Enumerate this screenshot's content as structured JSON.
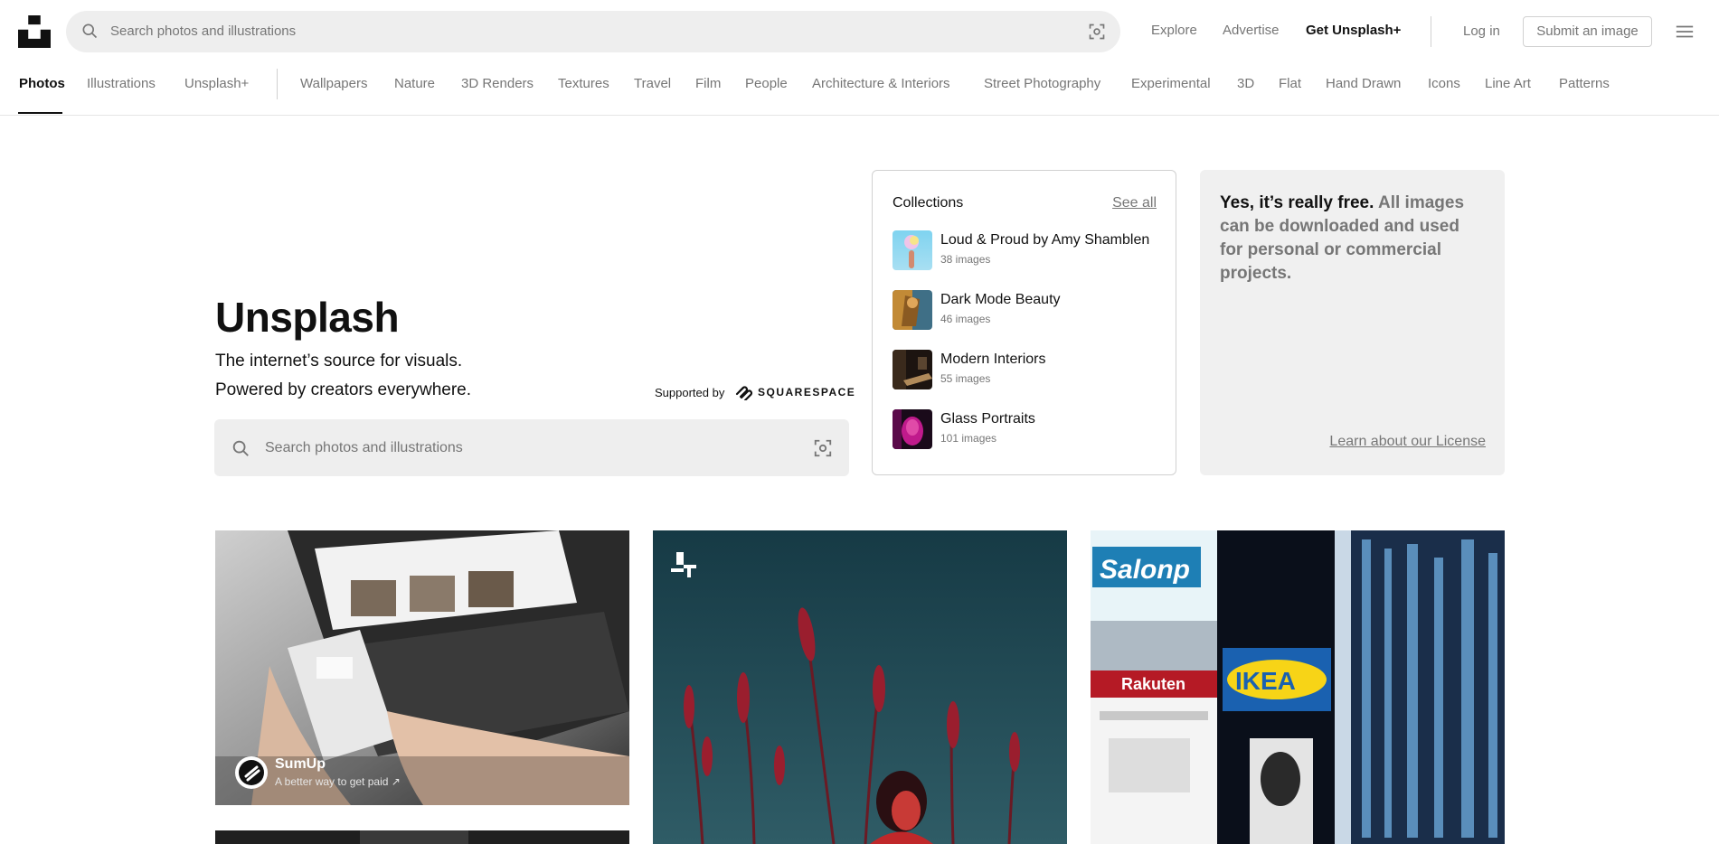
{
  "header": {
    "search_placeholder": "Search photos and illustrations",
    "links": {
      "explore": "Explore",
      "advertise": "Advertise",
      "get_plus": "Get Unsplash+",
      "login": "Log in"
    },
    "submit_label": "Submit an image"
  },
  "tabs": {
    "primary": [
      "Photos",
      "Illustrations",
      "Unsplash+"
    ],
    "topics": [
      "Wallpapers",
      "Nature",
      "3D Renders",
      "Textures",
      "Travel",
      "Film",
      "People",
      "Architecture & Interiors",
      "Street Photography",
      "Experimental",
      "3D",
      "Flat",
      "Hand Drawn",
      "Icons",
      "Line Art",
      "Patterns"
    ],
    "active": "Photos"
  },
  "hero": {
    "title": "Unsplash",
    "subtitle_line1": "The internet’s source for visuals.",
    "subtitle_line2": "Powered by creators everywhere.",
    "supported_by": "Supported by",
    "sponsor_brand": "SQUARESPACE",
    "search_placeholder": "Search photos and illustrations"
  },
  "collections": {
    "heading": "Collections",
    "see_all": "See all",
    "items": [
      {
        "name": "Loud & Proud by Amy Shamblen",
        "count": "38 images"
      },
      {
        "name": "Dark Mode Beauty",
        "count": "46 images"
      },
      {
        "name": "Modern Interiors",
        "count": "55 images"
      },
      {
        "name": "Glass Portraits",
        "count": "101 images"
      }
    ]
  },
  "free_card": {
    "bold": "Yes, it’s really free.",
    "rest": " All images can be downloaded and used for personal or commercial projects.",
    "license_link": "Learn about our License"
  },
  "grid": {
    "sponsored": {
      "name": "SumUp",
      "tagline": "A better way to get paid ↗"
    }
  },
  "colors": {
    "text": "#111111",
    "muted": "#767676",
    "search_bg": "#eeeeee",
    "border": "#d1d1d1",
    "card_bg": "#f0f0f0"
  }
}
